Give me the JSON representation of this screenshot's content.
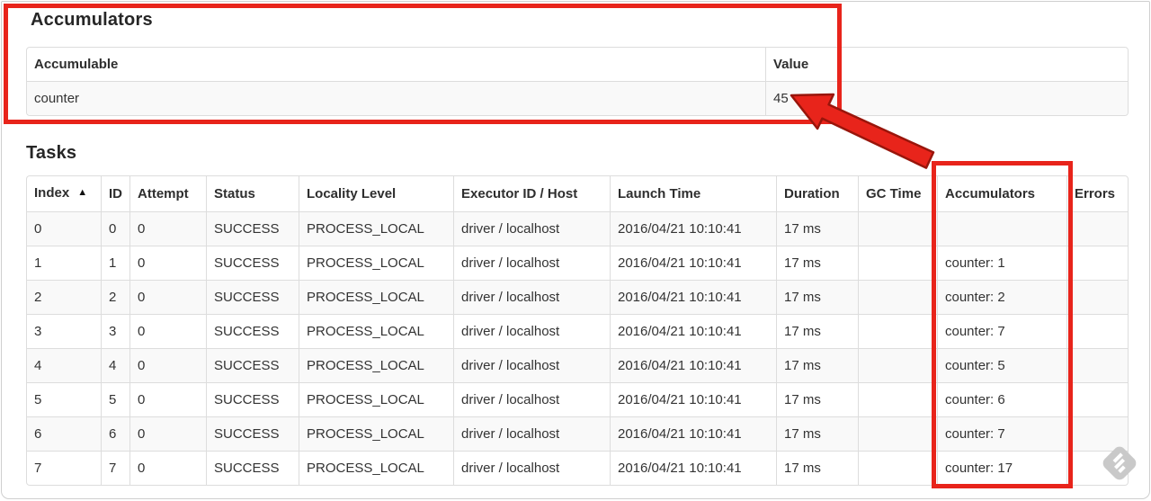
{
  "accumulators_section": {
    "title": "Accumulators",
    "table": {
      "headers": [
        "Accumulable",
        "Value"
      ],
      "rows": [
        {
          "accumulable": "counter",
          "value": "45"
        }
      ]
    }
  },
  "tasks_section": {
    "title": "Tasks",
    "table": {
      "headers": [
        "Index",
        "ID",
        "Attempt",
        "Status",
        "Locality Level",
        "Executor ID / Host",
        "Launch Time",
        "Duration",
        "GC Time",
        "Accumulators",
        "Errors"
      ],
      "sort_indicator": "▲",
      "sorted_column": "Index",
      "rows": [
        {
          "index": "0",
          "id": "0",
          "attempt": "0",
          "status": "SUCCESS",
          "locality": "PROCESS_LOCAL",
          "executor": "driver / localhost",
          "launch": "2016/04/21 10:10:41",
          "duration": "17 ms",
          "gc": "",
          "accumulators": "",
          "errors": ""
        },
        {
          "index": "1",
          "id": "1",
          "attempt": "0",
          "status": "SUCCESS",
          "locality": "PROCESS_LOCAL",
          "executor": "driver / localhost",
          "launch": "2016/04/21 10:10:41",
          "duration": "17 ms",
          "gc": "",
          "accumulators": "counter: 1",
          "errors": ""
        },
        {
          "index": "2",
          "id": "2",
          "attempt": "0",
          "status": "SUCCESS",
          "locality": "PROCESS_LOCAL",
          "executor": "driver / localhost",
          "launch": "2016/04/21 10:10:41",
          "duration": "17 ms",
          "gc": "",
          "accumulators": "counter: 2",
          "errors": ""
        },
        {
          "index": "3",
          "id": "3",
          "attempt": "0",
          "status": "SUCCESS",
          "locality": "PROCESS_LOCAL",
          "executor": "driver / localhost",
          "launch": "2016/04/21 10:10:41",
          "duration": "17 ms",
          "gc": "",
          "accumulators": "counter: 7",
          "errors": ""
        },
        {
          "index": "4",
          "id": "4",
          "attempt": "0",
          "status": "SUCCESS",
          "locality": "PROCESS_LOCAL",
          "executor": "driver / localhost",
          "launch": "2016/04/21 10:10:41",
          "duration": "17 ms",
          "gc": "",
          "accumulators": "counter: 5",
          "errors": ""
        },
        {
          "index": "5",
          "id": "5",
          "attempt": "0",
          "status": "SUCCESS",
          "locality": "PROCESS_LOCAL",
          "executor": "driver / localhost",
          "launch": "2016/04/21 10:10:41",
          "duration": "17 ms",
          "gc": "",
          "accumulators": "counter: 6",
          "errors": ""
        },
        {
          "index": "6",
          "id": "6",
          "attempt": "0",
          "status": "SUCCESS",
          "locality": "PROCESS_LOCAL",
          "executor": "driver / localhost",
          "launch": "2016/04/21 10:10:41",
          "duration": "17 ms",
          "gc": "",
          "accumulators": "counter: 7",
          "errors": ""
        },
        {
          "index": "7",
          "id": "7",
          "attempt": "0",
          "status": "SUCCESS",
          "locality": "PROCESS_LOCAL",
          "executor": "driver / localhost",
          "launch": "2016/04/21 10:10:41",
          "duration": "17 ms",
          "gc": "",
          "accumulators": "counter: 17",
          "errors": ""
        }
      ]
    }
  },
  "annotations": {
    "highlight_color": "#e8241b",
    "arrow_outline_color": "#99150b",
    "watermark_color": "#c9c9c9",
    "watermark_icon": "skitch-logo"
  }
}
